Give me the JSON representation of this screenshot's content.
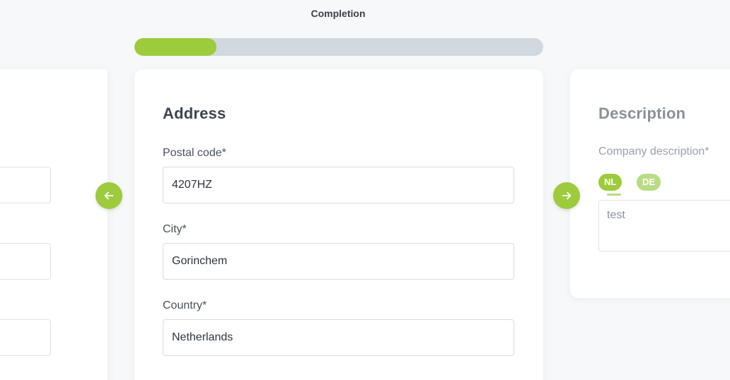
{
  "completion": {
    "label": "Completion",
    "progress": 0.2
  },
  "address_card": {
    "title": "Address",
    "fields": [
      {
        "label": "Postal code*",
        "value": "4207HZ"
      },
      {
        "label": "City*",
        "value": "Gorinchem"
      },
      {
        "label": "Country*",
        "value": "Netherlands"
      }
    ]
  },
  "description_card": {
    "title": "Description",
    "label": "Company description*",
    "languages": [
      "NL",
      "DE"
    ],
    "active_language": "NL",
    "text": "test"
  },
  "icons": {
    "prev": "arrow-left-icon",
    "next": "arrow-right-icon"
  },
  "colors": {
    "accent": "#9ccb3b",
    "accent_light": "#b8dc84",
    "track": "#cfd9df"
  }
}
